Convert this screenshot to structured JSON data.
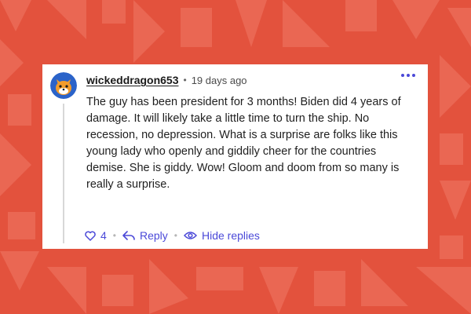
{
  "comment": {
    "username": "wickeddragon653",
    "separator": "•",
    "time": "19 days ago",
    "body": "The guy has been president for 3 months! Biden did 4 years of damage. It will likely take a little time to turn the ship. No recession, no depression. What is a surprise are folks like this young lady who openly and giddily cheer for the countries demise. She is giddy. Wow! Gloom and doom from so many is really a surprise.",
    "likes": "4",
    "reply_label": "Reply",
    "hide_replies_label": "Hide replies",
    "dot_sep": "•"
  },
  "icons": {
    "avatar": "fox-avatar-icon",
    "more": "more-options-icon",
    "like": "heart-icon",
    "reply": "reply-arrow-icon",
    "hide": "eye-icon"
  },
  "colors": {
    "background": "#e3523d",
    "pattern": "#ec6b57",
    "accent": "#4b49d8",
    "avatar_bg": "#2b63c9",
    "avatar_fox": "#f39c2b"
  }
}
